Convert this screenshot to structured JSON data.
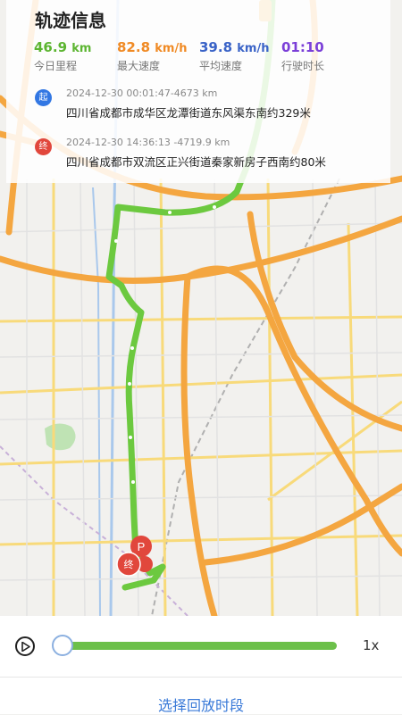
{
  "info_card": {
    "title": "轨迹信息",
    "stats": [
      {
        "value": "46.9",
        "unit": "km",
        "label": "今日里程",
        "color": "#5cb531"
      },
      {
        "value": "82.8",
        "unit": "km/h",
        "label": "最大速度",
        "color": "#f08a24"
      },
      {
        "value": "39.8",
        "unit": "km/h",
        "label": "平均速度",
        "color": "#3a63c7"
      },
      {
        "value": "01:10",
        "unit": "",
        "label": "行驶时长",
        "color": "#7b3fd8"
      }
    ],
    "start": {
      "badge": "起",
      "meta": "2024-12-30 00:01:47-4673 km",
      "address": "四川省成都市成华区龙潭街道东风渠东南约329米"
    },
    "end": {
      "badge": "终",
      "meta": "2024-12-30 14:36:13 -4719.9 km",
      "address": "四川省成都市双流区正兴街道秦家新房子西南约80米"
    }
  },
  "map": {
    "markers": {
      "parking": "P",
      "end": "终"
    },
    "colors": {
      "route": "#6cc93f",
      "major_road": "#f4a640",
      "minor_road": "#f8da7a",
      "water": "#a9c8ec",
      "park": "#bfe3b4"
    }
  },
  "controls": {
    "play_icon": "play-icon",
    "progress": 0,
    "speed": "1x"
  },
  "footer": {
    "button_label": "选择回放时段"
  }
}
